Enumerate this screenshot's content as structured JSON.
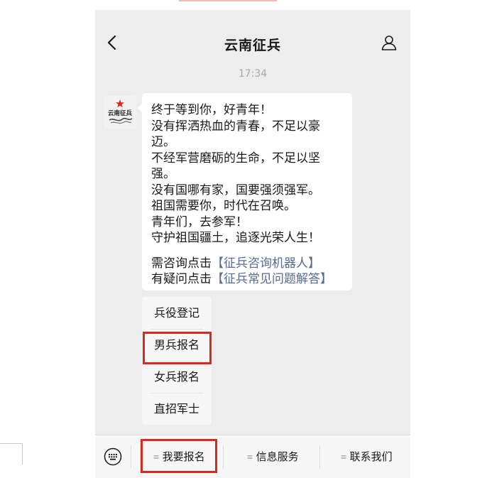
{
  "header": {
    "title": "云南征兵",
    "back_icon": "chevron-left-icon",
    "profile_icon": "person-icon"
  },
  "chat": {
    "time": "17:34",
    "sender_avatar_text": "云南征兵",
    "message_lines": [
      "终于等到你，好青年！",
      "没有挥洒热血的青春，不足以豪",
      "迈。",
      "不经军营磨砺的生命，不足以坚",
      "强。",
      "没有国哪有家，国要强须强军。",
      "祖国需要你，时代在召唤。",
      "青年们，去参军！",
      "守护祖国疆土，追逐光荣人生！"
    ],
    "consult_prefix": "需咨询点击",
    "consult_link": "【征兵咨询机器人】",
    "faq_prefix": "有疑问点击",
    "faq_link": "【征兵常见问题解答】"
  },
  "submenu": {
    "items": [
      {
        "label": "兵役登记"
      },
      {
        "label": "男兵报名"
      },
      {
        "label": "女兵报名"
      },
      {
        "label": "直招军士"
      }
    ]
  },
  "bottom_menu": {
    "keyboard_icon": "keyboard-icon",
    "items": [
      {
        "label": "我要报名"
      },
      {
        "label": "信息服务"
      },
      {
        "label": "联系我们"
      }
    ]
  },
  "colors": {
    "link": "#576b95",
    "highlight_box": "#d9281c",
    "chat_background": "#ededed"
  }
}
